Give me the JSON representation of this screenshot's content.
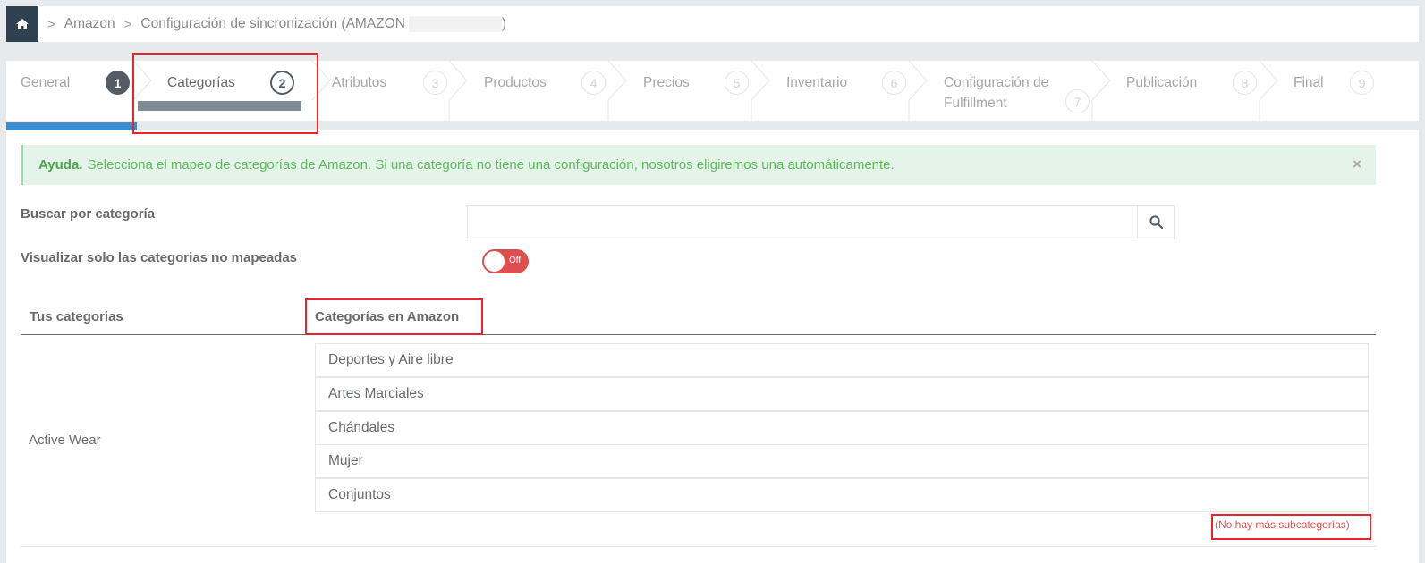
{
  "breadcrumb": {
    "items": [
      "Amazon",
      "Configuración de sincronización (AMAZON",
      ")"
    ],
    "separator": ">"
  },
  "wizard": {
    "steps": [
      {
        "label": "General",
        "num": "1",
        "state": "done"
      },
      {
        "label": "Categorías",
        "num": "2",
        "state": "current"
      },
      {
        "label": "Atributos",
        "num": "3",
        "state": "pending"
      },
      {
        "label": "Productos",
        "num": "4",
        "state": "pending"
      },
      {
        "label": "Precios",
        "num": "5",
        "state": "pending"
      },
      {
        "label": "Inventario",
        "num": "6",
        "state": "pending"
      },
      {
        "label": "Configuración de Fulfillment",
        "num": "7",
        "state": "pending"
      },
      {
        "label": "Publicación",
        "num": "8",
        "state": "pending"
      },
      {
        "label": "Final",
        "num": "9",
        "state": "pending"
      }
    ],
    "progress_fraction": 0.0925
  },
  "alert": {
    "title": "Ayuda.",
    "message": "Selecciona el mapeo de categorías de Amazon. Si una categoría no tiene una configuración, nosotros eligiremos una automáticamente.",
    "close": "×"
  },
  "search": {
    "label": "Buscar por categoría",
    "value": "",
    "placeholder": ""
  },
  "filter": {
    "label": "Visualizar solo las categorias no mapeadas",
    "toggle_text": "Off",
    "toggle_state": "off"
  },
  "table": {
    "col_yours": "Tus categorias",
    "col_amazon": "Categorías en Amazon",
    "rows": [
      {
        "category": "Active Wear",
        "amazon_path": [
          "Deportes y Aire libre",
          "Artes Marciales",
          "Chándales",
          "Mujer",
          "Conjuntos"
        ],
        "note": "(No hay más subcategorías)"
      }
    ]
  },
  "colors": {
    "sidebar_dark": "#2f4050",
    "progress_blue": "#3c8dcd",
    "toggle_off_red": "#de4e4e",
    "alert_green": "#5cb95c",
    "highlight_red": "#e8232a"
  },
  "icons": [
    "home-icon",
    "search-icon",
    "close-icon"
  ]
}
